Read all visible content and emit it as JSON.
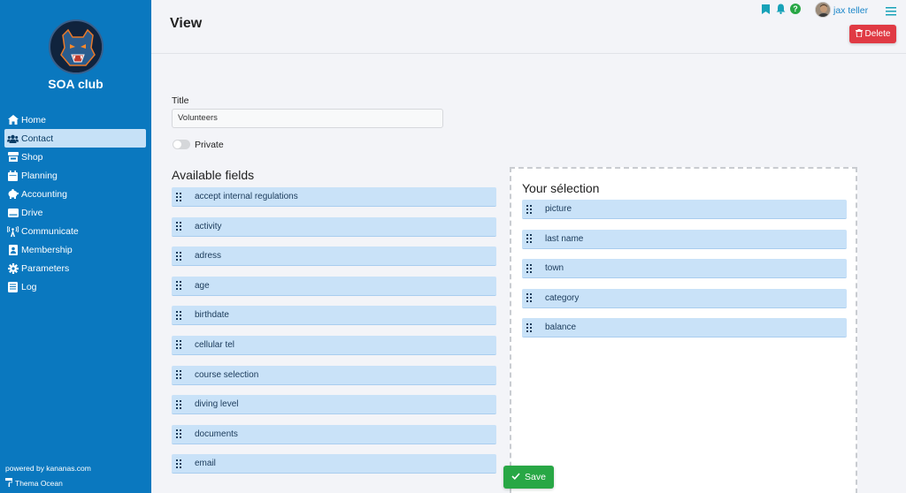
{
  "sidebar": {
    "club_name": "SOA club",
    "nav": [
      {
        "label": "Home",
        "icon": "home-icon"
      },
      {
        "label": "Contact",
        "icon": "users-icon",
        "active": true
      },
      {
        "label": "Shop",
        "icon": "shop-icon"
      },
      {
        "label": "Planning",
        "icon": "calendar-icon"
      },
      {
        "label": "Accounting",
        "icon": "piggy-bank-icon"
      },
      {
        "label": "Drive",
        "icon": "drive-icon"
      },
      {
        "label": "Communicate",
        "icon": "broadcast-icon"
      },
      {
        "label": "Membership",
        "icon": "id-card-icon"
      },
      {
        "label": "Parameters",
        "icon": "gear-icon"
      },
      {
        "label": "Log",
        "icon": "log-icon"
      }
    ],
    "powered_by": "powered by kananas.com",
    "theme": "Thema Ocean"
  },
  "header": {
    "title": "View",
    "username": "jax teller",
    "delete_label": "Delete"
  },
  "form": {
    "title_label": "Title",
    "title_value": "Volunteers",
    "private_label": "Private",
    "available_title": "Available fields",
    "available_fields": [
      "accept internal regulations",
      "activity",
      "adress",
      "age",
      "birthdate",
      "cellular tel",
      "course selection",
      "diving level",
      "documents",
      "email"
    ],
    "selection_title": "Your sélection",
    "selection_fields": [
      "picture",
      "last name",
      "town",
      "category",
      "balance"
    ],
    "save_label": "Save"
  },
  "colors": {
    "sidebar": "#0a78bf",
    "field_bg": "#c9e2f8",
    "delete": "#e03a44",
    "save": "#28a745",
    "link": "#1b86c9"
  }
}
